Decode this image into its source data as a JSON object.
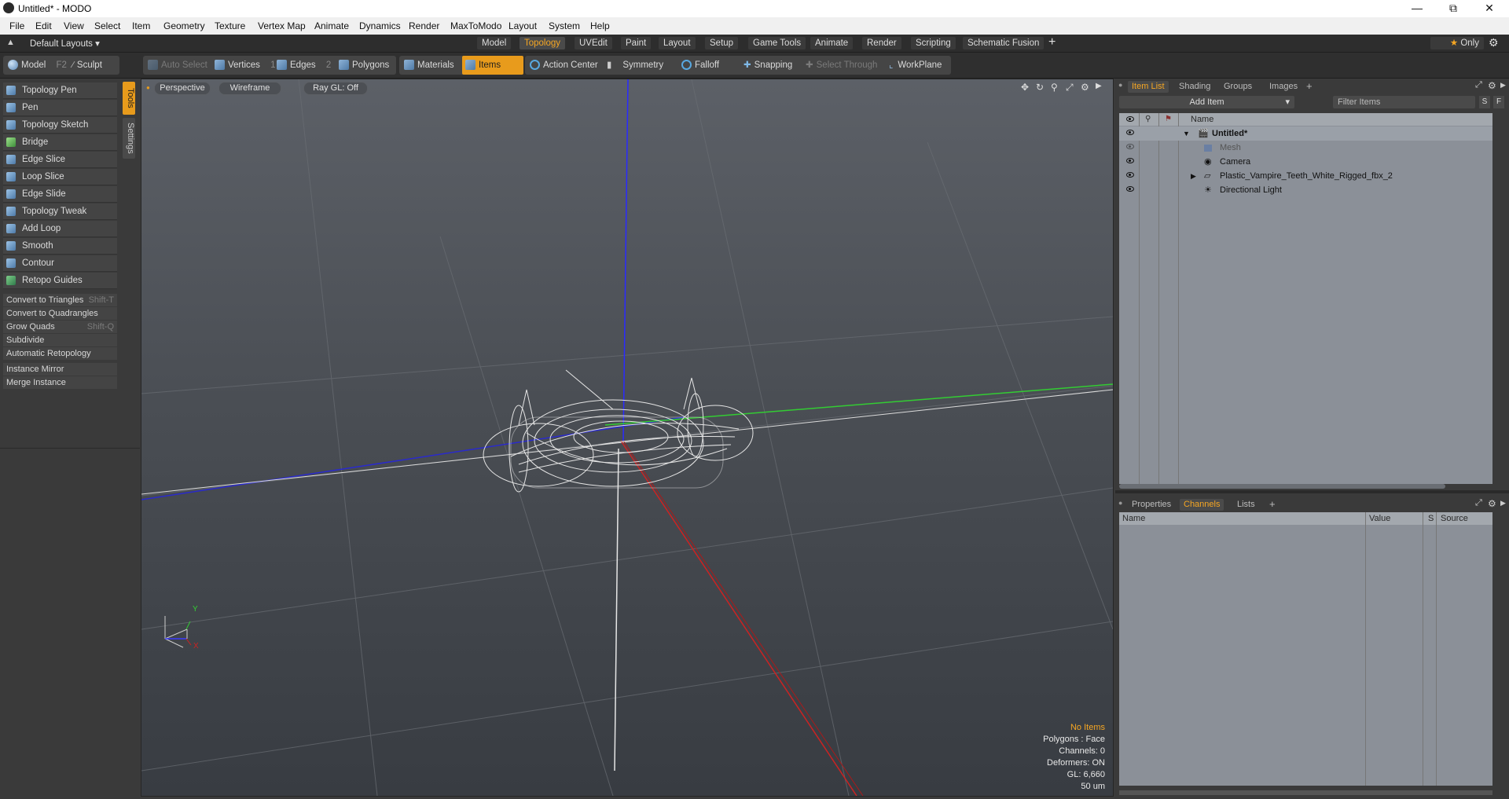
{
  "window": {
    "title": "Untitled* - MODO",
    "controls": [
      "minimize-icon",
      "restore-icon",
      "close-icon"
    ]
  },
  "menubar": [
    "File",
    "Edit",
    "View",
    "Select",
    "Item",
    "Geometry",
    "Texture",
    "Vertex Map",
    "Animate",
    "Dynamics",
    "Render",
    "MaxToModo",
    "Layout",
    "System",
    "Help"
  ],
  "layoutbar": {
    "layouts_label": "Default Layouts",
    "tabs": [
      "Model",
      "Topology",
      "UVEdit",
      "Paint",
      "Layout",
      "Setup",
      "Game Tools",
      "Animate",
      "Render",
      "Scripting",
      "Schematic Fusion"
    ],
    "active_tab": "Topology",
    "add_symbol": "+",
    "only_label": "Only"
  },
  "toolbar": {
    "model": "Model",
    "model_key": "F2",
    "sculpt": "Sculpt",
    "auto_select": "Auto Select",
    "vertices": "Vertices",
    "vertices_key": "1",
    "edges": "Edges",
    "edges_key": "2",
    "polygons": "Polygons",
    "materials": "Materials",
    "items": "Items",
    "action_center": "Action Center",
    "symmetry": "Symmetry",
    "falloff": "Falloff",
    "snapping": "Snapping",
    "select_through": "Select Through",
    "workplane": "WorkPlane"
  },
  "tools": {
    "side_tabs": [
      "Tools",
      "Settings"
    ],
    "main": [
      "Topology Pen",
      "Pen",
      "Topology Sketch",
      "Bridge",
      "Edge Slice",
      "Loop Slice",
      "Edge Slide",
      "Topology Tweak",
      "Add Loop",
      "Smooth",
      "Contour",
      "Retopo Guides"
    ],
    "commands": [
      {
        "label": "Convert to Triangles",
        "shortcut": "Shift-T"
      },
      {
        "label": "Convert to Quadrangles",
        "shortcut": ""
      },
      {
        "label": "Grow Quads",
        "shortcut": "Shift-Q"
      },
      {
        "label": "Subdivide",
        "shortcut": ""
      },
      {
        "label": "Automatic Retopology",
        "shortcut": ""
      }
    ],
    "instance": [
      "Instance Mirror",
      "Merge Instance"
    ]
  },
  "viewport": {
    "view_mode": "Perspective",
    "shading": "Wireframe",
    "raygl": "Ray GL: Off",
    "stats": {
      "items": "No Items",
      "polygons": "Polygons : Face",
      "channels": "Channels: 0",
      "deformers": "Deformers: ON",
      "gl": "GL: 6,660",
      "unit": "50 um"
    },
    "axis_y": "Y",
    "axis_x": "X"
  },
  "itemlist": {
    "tabs": [
      "Item List",
      "Shading",
      "Groups",
      "Images"
    ],
    "active_tab": "Item List",
    "add_item": "Add Item",
    "filter_placeholder": "Filter Items",
    "s_btn": "S",
    "f_btn": "F",
    "column_name": "Name",
    "items": [
      {
        "name": "Untitled*",
        "level": 0
      },
      {
        "name": "Mesh",
        "level": 1
      },
      {
        "name": "Camera",
        "level": 1
      },
      {
        "name": "Plastic_Vampire_Teeth_White_Rigged_fbx_2",
        "level": 1
      },
      {
        "name": "Directional Light",
        "level": 1
      }
    ]
  },
  "channels": {
    "tabs": [
      "Properties",
      "Channels",
      "Lists"
    ],
    "active_tab": "Channels",
    "columns": [
      "Name",
      "Value",
      "S",
      "Source"
    ]
  },
  "colors": {
    "accent": "#f5a623",
    "panel": "#3a3a3a",
    "list_bg": "#8b9098"
  }
}
